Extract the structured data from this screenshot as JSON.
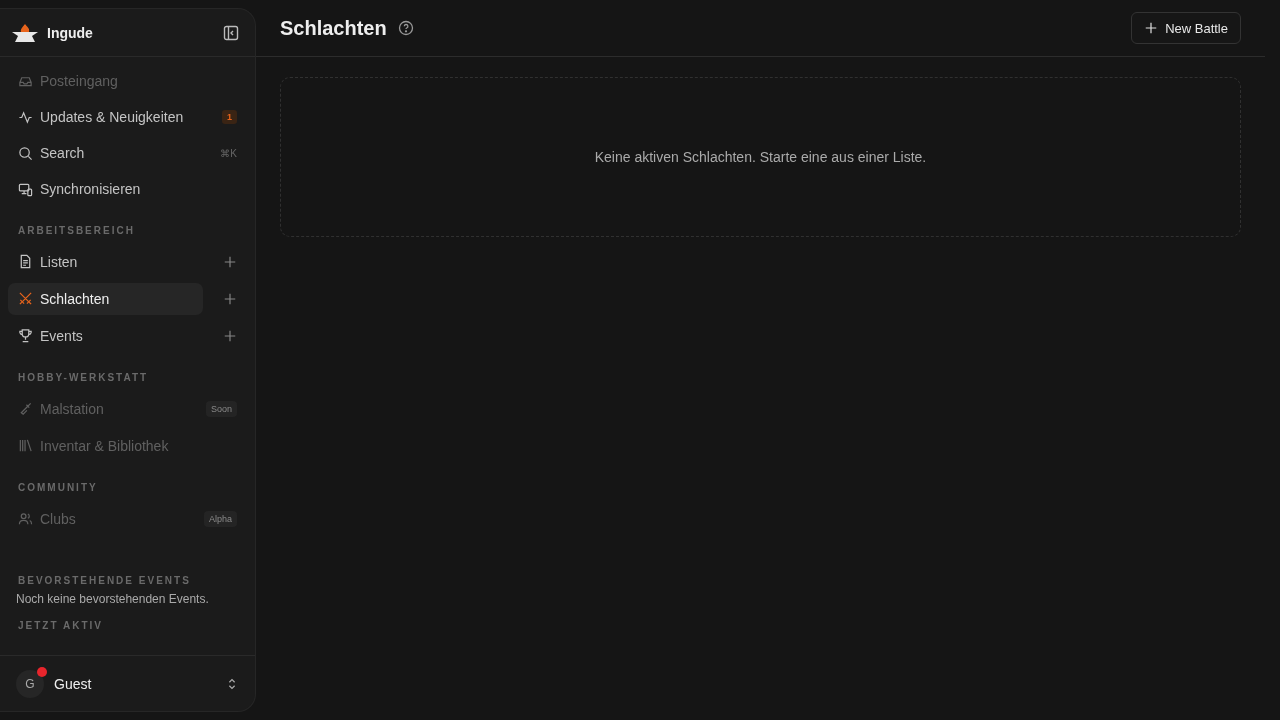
{
  "sidebar": {
    "brand": "Ingude",
    "top_items": [
      {
        "label": "Posteingang",
        "kind": "inbox",
        "disabled": true
      },
      {
        "label": "Updates & Neuigkeiten",
        "kind": "activity",
        "disabled": false,
        "badge": "1"
      },
      {
        "label": "Search",
        "kind": "search",
        "disabled": false,
        "shortcut": "⌘K"
      },
      {
        "label": "Synchronisieren",
        "kind": "devices",
        "disabled": false
      }
    ],
    "sections": [
      {
        "title": "ARBEITSBEREICH",
        "items": [
          {
            "label": "Listen",
            "kind": "file",
            "disabled": false,
            "selected": false,
            "add": true
          },
          {
            "label": "Schlachten",
            "kind": "swords",
            "disabled": false,
            "selected": true,
            "add": true
          },
          {
            "label": "Events",
            "kind": "trophy",
            "disabled": false,
            "selected": false,
            "add": true
          }
        ]
      },
      {
        "title": "HOBBY-WERKSTATT",
        "items": [
          {
            "label": "Malstation",
            "kind": "brush",
            "disabled": true,
            "selected": false,
            "tag": "Soon"
          },
          {
            "label": "Inventar & Bibliothek",
            "kind": "library",
            "disabled": true,
            "selected": false
          }
        ]
      },
      {
        "title": "COMMUNITY",
        "items": [
          {
            "label": "Clubs",
            "kind": "users",
            "disabled": true,
            "selected": false,
            "tag": "Alpha"
          }
        ]
      }
    ],
    "panels": [
      {
        "title": "BEVORSTEHENDE EVENTS",
        "text": "Noch keine bevorstehenden Events."
      },
      {
        "title": "JETZT AKTIV"
      }
    ],
    "user": {
      "initial": "G",
      "name": "Guest",
      "notification": true
    }
  },
  "page": {
    "title": "Schlachten",
    "new_button": "New Battle",
    "empty_message": "Keine aktiven Schlachten. Starte eine aus einer Liste."
  }
}
